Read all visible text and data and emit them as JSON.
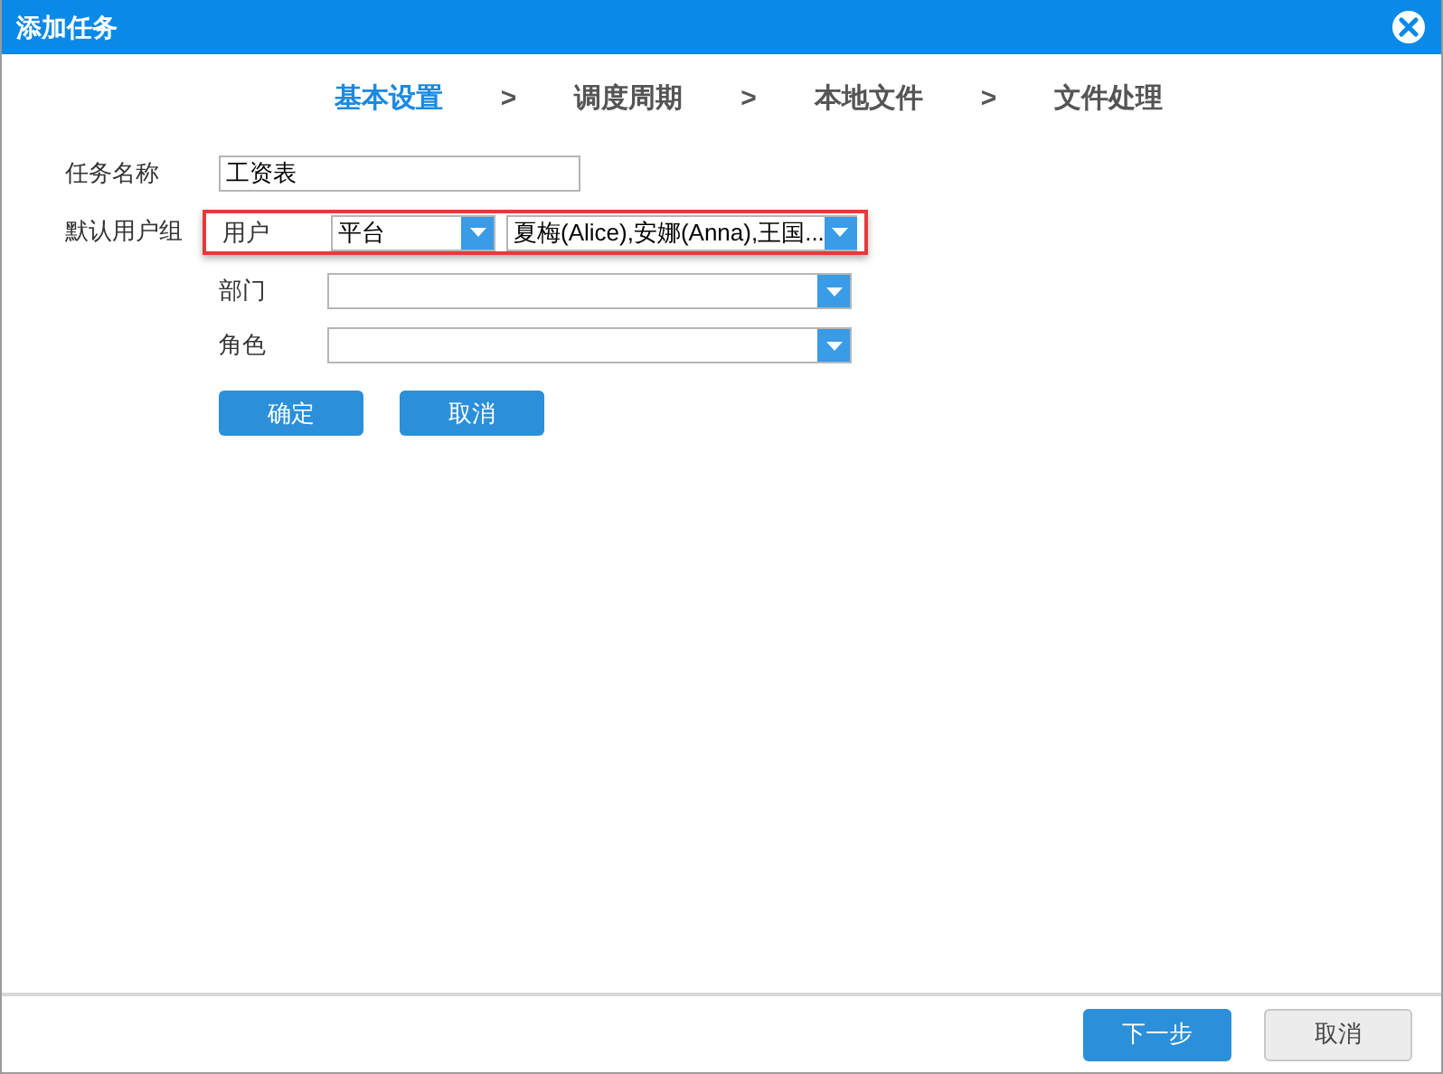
{
  "window": {
    "title": "添加任务"
  },
  "steps": [
    {
      "label": "基本设置",
      "selected": true
    },
    {
      "label": "调度周期",
      "selected": false
    },
    {
      "label": "本地文件",
      "selected": false
    },
    {
      "label": "文件处理",
      "selected": false
    }
  ],
  "step_separator": ">",
  "task_name": {
    "label": "任务名称",
    "value": "工资表"
  },
  "user_group": {
    "label": "默认用户组",
    "highlighted": true,
    "user": {
      "label": "用户",
      "source": "平台",
      "value": "夏梅(Alice),安娜(Anna),王国..."
    },
    "rows": [
      {
        "label": "部门"
      },
      {
        "label": "角色"
      }
    ],
    "buttons": [
      "确定",
      "取消"
    ]
  },
  "footer_buttons": [
    {
      "label": "下一步",
      "kind": "primary"
    },
    {
      "label": "取消",
      "kind": "secondary"
    }
  ]
}
